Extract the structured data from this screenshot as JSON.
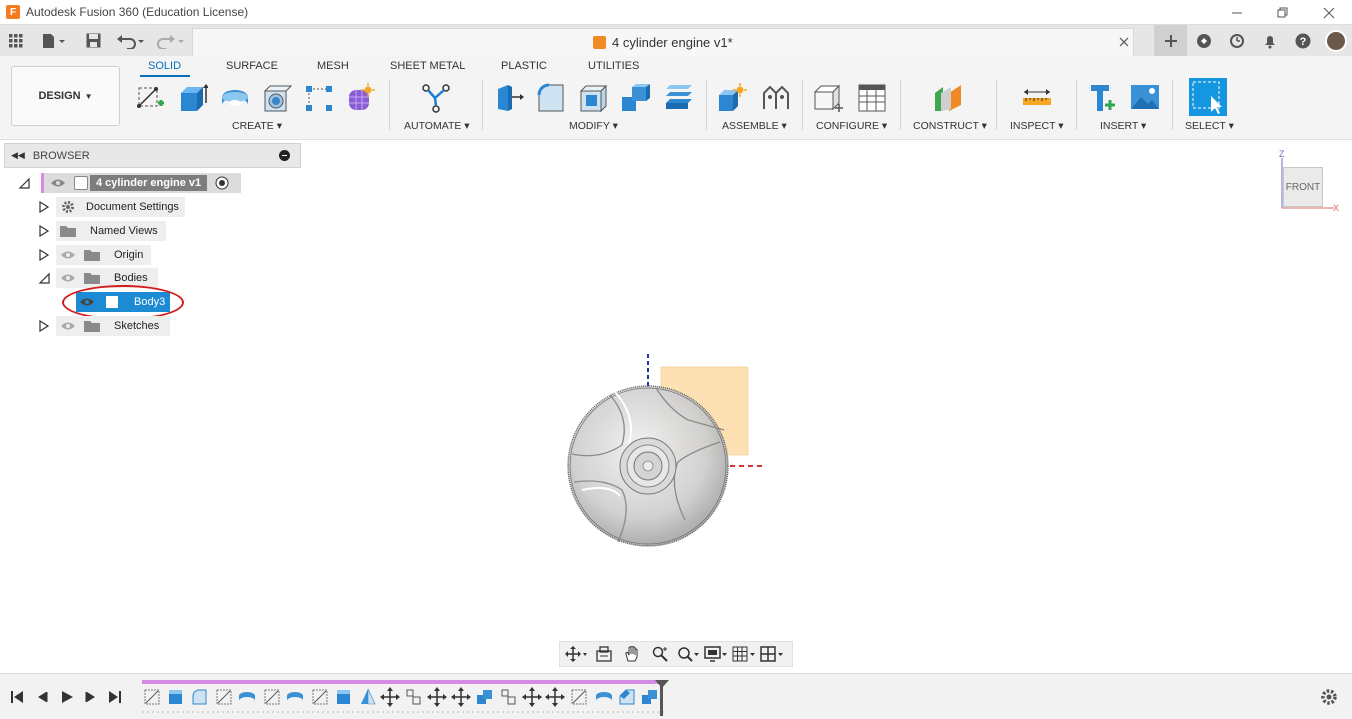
{
  "window": {
    "title": "Autodesk Fusion 360 (Education License)",
    "controls": [
      "minimize",
      "restore",
      "close"
    ]
  },
  "tabbar": {
    "document_tab_label": "4 cylinder engine v1*"
  },
  "toolbar": {
    "workspace_button": "DESIGN",
    "tabs": [
      "SOLID",
      "SURFACE",
      "MESH",
      "SHEET METAL",
      "PLASTIC",
      "UTILITIES"
    ],
    "active_tab": "SOLID",
    "groups": {
      "create": "CREATE",
      "automate": "AUTOMATE",
      "modify": "MODIFY",
      "assemble": "ASSEMBLE",
      "configure": "CONFIGURE",
      "construct": "CONSTRUCT",
      "inspect": "INSPECT",
      "insert": "INSERT",
      "select": "SELECT"
    }
  },
  "browser": {
    "title": "BROWSER",
    "root": "4 cylinder engine v1",
    "items": [
      {
        "label": "Document Settings"
      },
      {
        "label": "Named Views"
      },
      {
        "label": "Origin"
      },
      {
        "label": "Bodies"
      },
      {
        "label": "Body3"
      },
      {
        "label": "Sketches"
      }
    ]
  },
  "viewcube": {
    "face": "FRONT",
    "axis_z": "Z",
    "axis_x": "X"
  },
  "colors": {
    "accent": "#0a6fb8",
    "selection": "#1d8bd3",
    "highlight_circle": "#d31d1d",
    "timeline_track": "#d58be3",
    "component_marker": "#d88be0"
  }
}
